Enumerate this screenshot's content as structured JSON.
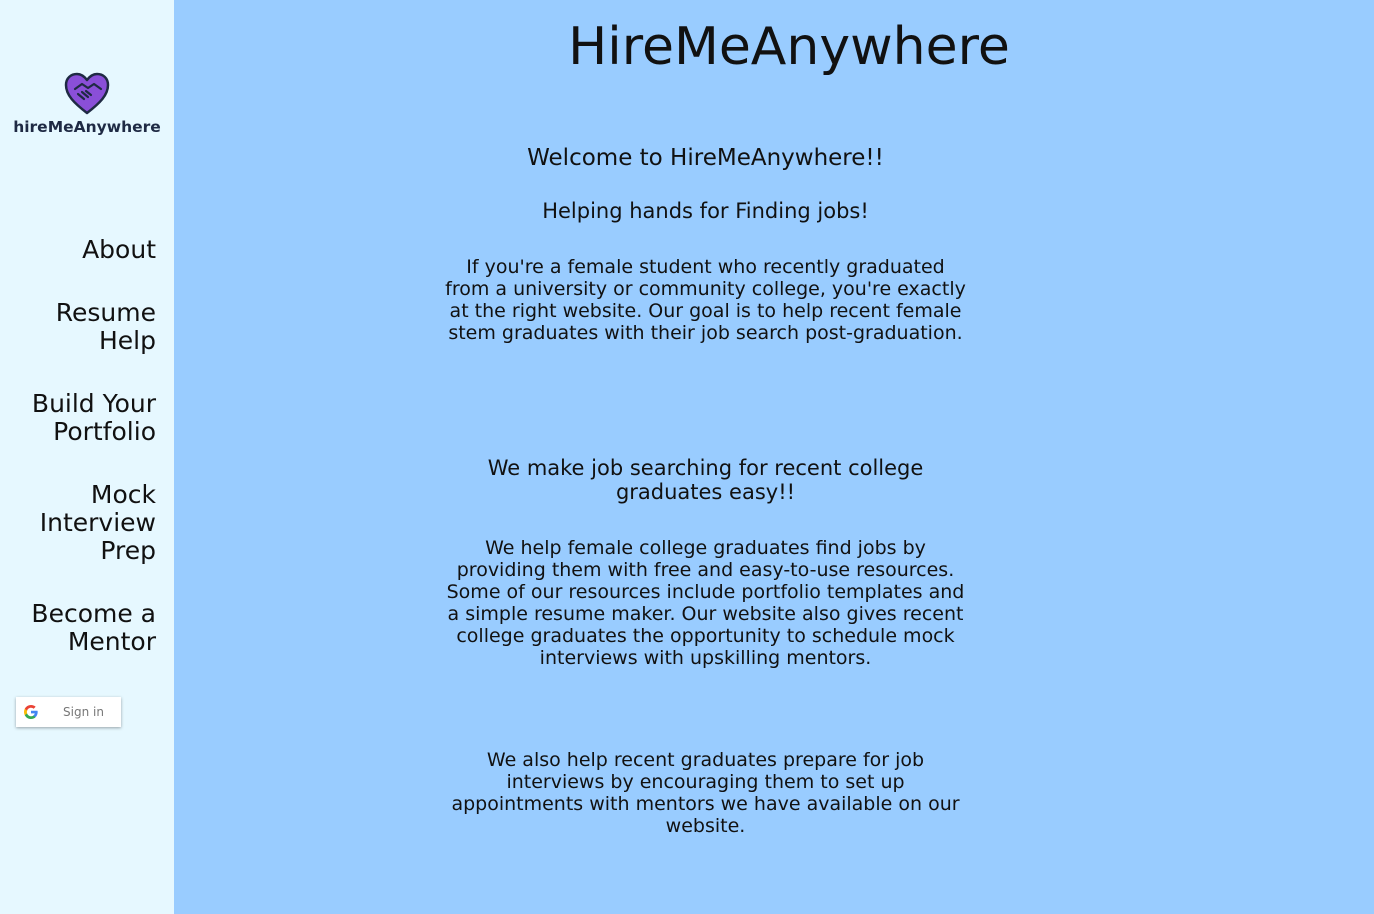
{
  "sidebar": {
    "logo_text": "hireMeAnywhere",
    "logo_icon": "heart-handshake-icon",
    "nav": [
      {
        "label_lines": [
          "About"
        ]
      },
      {
        "label_lines": [
          "Resume",
          "Help"
        ]
      },
      {
        "label_lines": [
          "Build Your",
          "Portfolio"
        ]
      },
      {
        "label_lines": [
          "Mock",
          "Interview",
          "Prep"
        ]
      },
      {
        "label_lines": [
          "Become a",
          "Mentor"
        ]
      }
    ],
    "signin_label": "Sign in",
    "signin_icon": "google-icon"
  },
  "main": {
    "title": "HireMeAnywhere",
    "welcome": "Welcome to HireMeAnywhere!!",
    "tagline": "Helping hands for Finding jobs!",
    "intro": "If you're a female student who recently graduated from a university or community college, you're exactly at the right website. Our goal is to help recent female stem graduates with their job search post-graduation.",
    "easy": "We make job searching for recent college graduates easy!!",
    "help": "We help female college graduates find jobs by providing them with free and easy-to-use resources. Some of our resources include portfolio templates and a simple resume maker. Our website also gives recent college graduates the opportunity to schedule mock interviews with upskilling mentors.",
    "prep": "We also help recent graduates prepare for job interviews by encouraging them to set up appointments with mentors we have available on our website."
  },
  "colors": {
    "sidebar_bg": "#e6f8ff",
    "main_bg": "#99ccff",
    "logo_purple": "#8a4fd8",
    "logo_text": "#1f2a44"
  }
}
